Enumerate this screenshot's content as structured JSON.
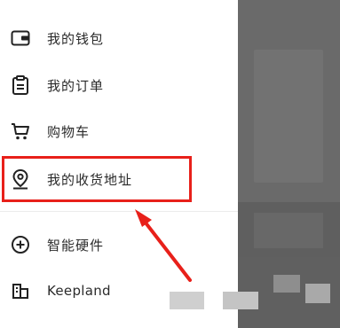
{
  "menu": {
    "items": [
      {
        "label": "我的钱包",
        "icon": "wallet-icon"
      },
      {
        "label": "我的订单",
        "icon": "clipboard-icon"
      },
      {
        "label": "购物车",
        "icon": "cart-icon"
      },
      {
        "label": "我的收货地址",
        "icon": "location-pin-icon"
      },
      {
        "label": "智能硬件",
        "icon": "add-circle-icon"
      },
      {
        "label": "Keepland",
        "icon": "building-icon"
      }
    ]
  },
  "annotation": {
    "highlight_color": "#e8201a",
    "highlighted_item": "我的收货地址"
  }
}
